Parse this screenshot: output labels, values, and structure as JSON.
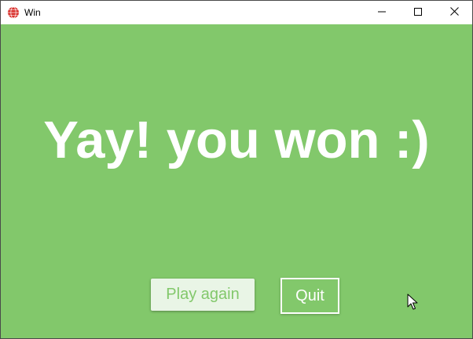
{
  "window": {
    "title": "Win",
    "app_icon": "globe-icon",
    "controls": {
      "minimize_icon": "minimize-icon",
      "maximize_icon": "maximize-icon",
      "close_icon": "close-icon"
    }
  },
  "main": {
    "message": "Yay! you won :)",
    "play_again_label": "Play again",
    "quit_label": "Quit"
  },
  "colors": {
    "background": "#82c86b",
    "text": "#ffffff",
    "play_button_bg": "#e9f5e6",
    "play_button_text": "#82c86b",
    "app_icon": "#d9302c"
  }
}
